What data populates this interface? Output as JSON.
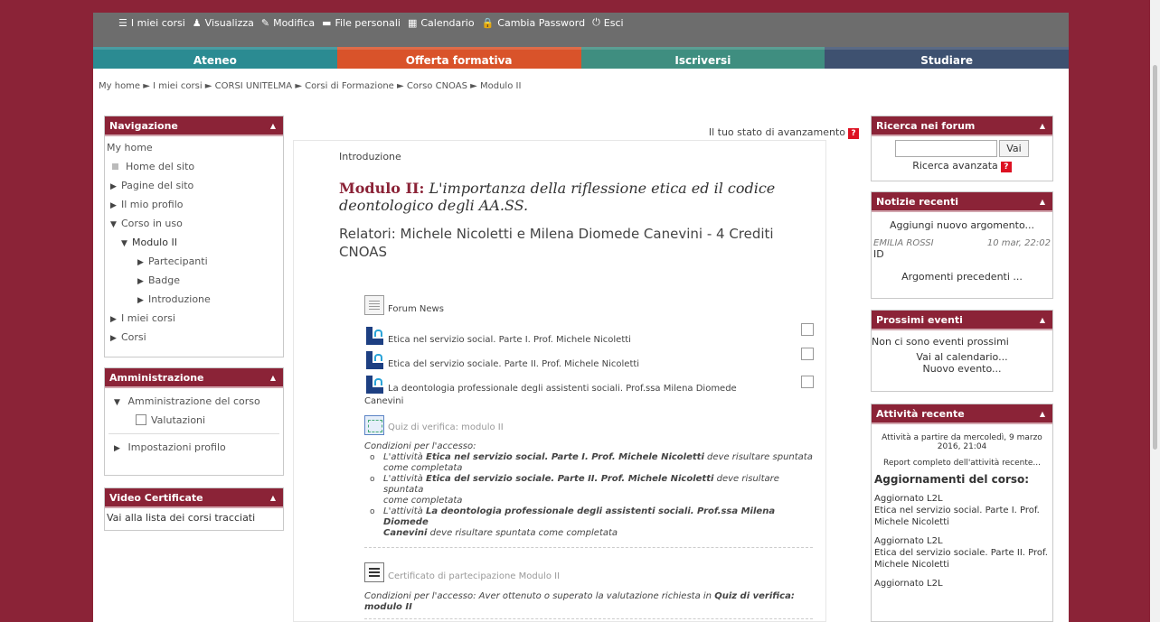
{
  "topbar": {
    "links": [
      {
        "icon": "list-icon",
        "glyph": "☰",
        "label": "I miei corsi"
      },
      {
        "icon": "user-icon",
        "glyph": "♟",
        "label": "Visualizza"
      },
      {
        "icon": "pencil-icon",
        "glyph": "✎",
        "label": "Modifica"
      },
      {
        "icon": "folder-icon",
        "glyph": "▬",
        "label": "File personali"
      },
      {
        "icon": "calendar-icon",
        "glyph": "▦",
        "label": "Calendario"
      },
      {
        "icon": "lock-icon",
        "glyph": "🔒",
        "label": "Cambia Password"
      },
      {
        "icon": "power-icon",
        "glyph": "⏻",
        "label": "Esci"
      }
    ]
  },
  "menu": {
    "items": [
      {
        "label": "Ateneo",
        "color": "#2b8b92"
      },
      {
        "label": "Offerta formativa",
        "color": "#d9532a"
      },
      {
        "label": "Iscriversi",
        "color": "#3f8e80"
      },
      {
        "label": "Studiare",
        "color": "#3e5170"
      }
    ]
  },
  "breadcrumb": "My home ► I miei corsi ► CORSI UNITELMA ► Corsi di Formazione ► Corso CNOAS ► Modulo II",
  "navigation": {
    "title": "Navigazione",
    "items": [
      "My home",
      "Home del sito",
      "Pagine del sito",
      "Il mio profilo",
      "Corso in uso",
      "Modulo II",
      "Partecipanti",
      "Badge",
      "Introduzione",
      "I miei corsi",
      "Corsi"
    ]
  },
  "admin": {
    "title": "Amministrazione",
    "course_admin": "Amministrazione del corso",
    "grades": "Valutazioni",
    "profile": "Impostazioni profilo"
  },
  "video": {
    "title": "Video Certificate",
    "link": "Vai alla lista dei corsi tracciati"
  },
  "main": {
    "status": "Il tuo stato di avanzamento",
    "intro": "Introduzione",
    "title_bold": "Modulo II:",
    "title_italic": "L'importanza della riflessione etica ed il codice deontologico degli AA.SS.",
    "subtitle": "Relatori: Michele Nicoletti e Milena Diomede Canevini - 4 Crediti CNOAS",
    "forum": "Forum News",
    "act1": "Etica nel servizio social. Parte I. Prof. Michele Nicoletti",
    "act2": "Etica del servizio sociale. Parte II. Prof. Michele Nicoletti",
    "act3a": "La deontologia professionale degli assistenti sociali. Prof.ssa Milena Diomede",
    "act3b": "Canevini",
    "quiz": "Quiz di verifica: modulo II",
    "cond_title": "Condizioni per l'accesso:",
    "cond1_pre": "L'attività ",
    "cond1_bold": "Etica nel servizio social. Parte I. Prof. Michele Nicoletti",
    "cond1_post": " deve risultare spuntata",
    "cond1_end": "come completata",
    "cond2_pre": "L'attività ",
    "cond2_bold": "Etica del servizio sociale. Parte II. Prof. Michele Nicoletti",
    "cond2_post": " deve risultare spuntata",
    "cond2_end": "come completata",
    "cond3_pre": "L'attività ",
    "cond3_bold": "La deontologia professionale degli assistenti sociali. Prof.ssa Milena Diomede",
    "cond3_bold2": "Canevini",
    "cond3_post": " deve risultare spuntata come completata",
    "cert": "Certificato di partecipazione Modulo II",
    "cert_cond_pre": "Condizioni per l'accesso: Aver ottenuto o superato la valutazione richiesta in ",
    "cert_cond_bold": "Quiz di verifica:",
    "cert_cond_bold2": "modulo II"
  },
  "forum_search": {
    "title": "Ricerca nei forum",
    "button": "Vai",
    "advanced": "Ricerca avanzata"
  },
  "news": {
    "title": "Notizie recenti",
    "add": "Aggiungi nuovo argomento...",
    "author": "EMILIA ROSSI",
    "date": "10 mar, 22:02",
    "post": "ID",
    "older": "Argomenti precedenti ..."
  },
  "events": {
    "title": "Prossimi eventi",
    "none": "Non ci sono eventi prossimi",
    "calendar": "Vai al calendario...",
    "new": "Nuovo evento..."
  },
  "recent": {
    "title": "Attività recente",
    "since1": "Attività a partire da mercoledì, 9 marzo",
    "since2": "2016, 21:04",
    "report": "Report completo dell'attività recente...",
    "updates": "Aggiornamenti del corso:",
    "u1_title": "Aggiornato L2L",
    "u1_text": "Etica nel servizio social. Parte I. Prof. Michele Nicoletti",
    "u2_title": "Aggiornato L2L",
    "u2_text": "Etica del servizio sociale. Parte II. Prof. Michele Nicoletti",
    "u3_title": "Aggiornato L2L"
  }
}
